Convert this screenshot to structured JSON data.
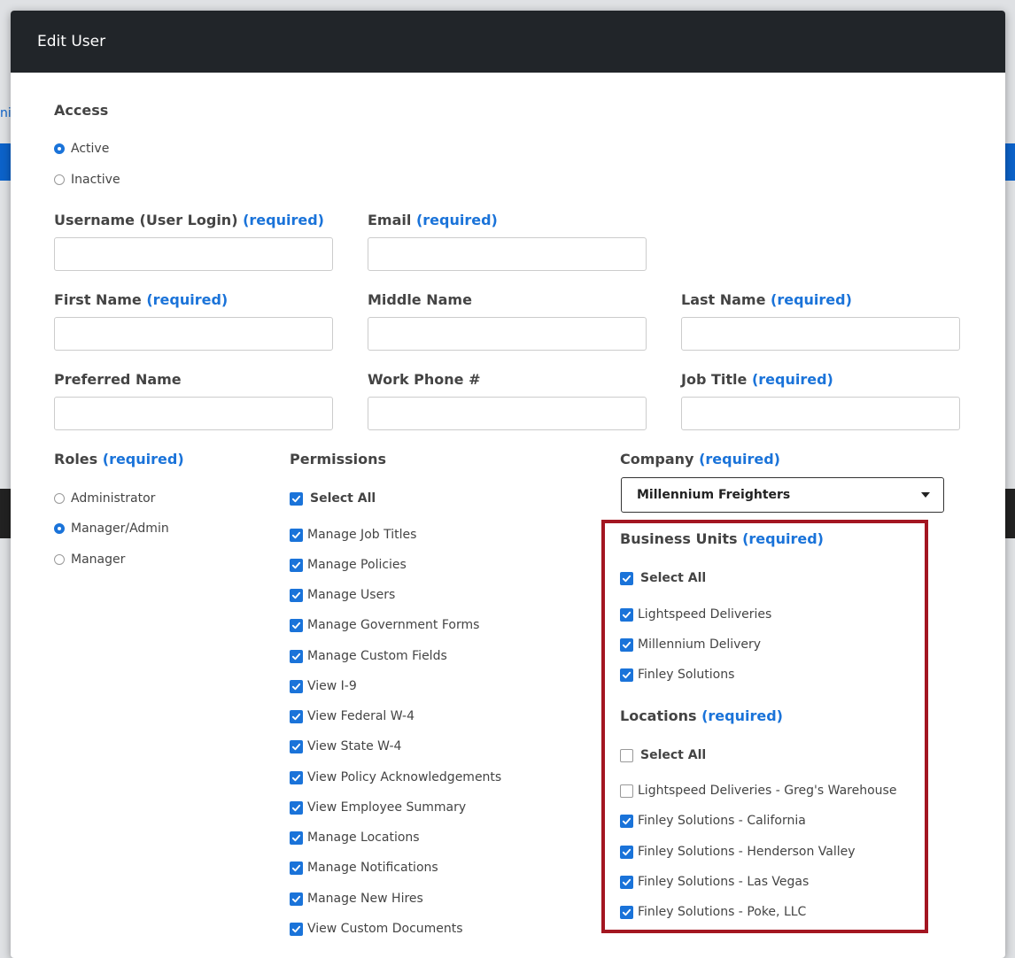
{
  "modal": {
    "title": "Edit User"
  },
  "access": {
    "title": "Access",
    "options": [
      {
        "label": "Active",
        "selected": true
      },
      {
        "label": "Inactive",
        "selected": false
      }
    ]
  },
  "required_text": "(required)",
  "fields": {
    "username": {
      "label": "Username (User Login)",
      "required": "(required)",
      "value": ""
    },
    "email": {
      "label": "Email",
      "required": "(required)",
      "value": ""
    },
    "first_name": {
      "label": "First Name",
      "required": "(required)",
      "value": ""
    },
    "middle_name": {
      "label": "Middle Name",
      "value": ""
    },
    "last_name": {
      "label": "Last Name",
      "required": "(required)",
      "value": ""
    },
    "preferred_name": {
      "label": "Preferred Name",
      "value": ""
    },
    "work_phone": {
      "label": "Work Phone #",
      "value": ""
    },
    "job_title": {
      "label": "Job Title",
      "required": "(required)",
      "value": ""
    }
  },
  "roles": {
    "title": "Roles",
    "required": "(required)",
    "options": [
      {
        "label": "Administrator",
        "selected": false
      },
      {
        "label": "Manager/Admin",
        "selected": true
      },
      {
        "label": "Manager",
        "selected": false
      }
    ]
  },
  "permissions": {
    "title": "Permissions",
    "select_all": {
      "label": "Select All",
      "checked": true
    },
    "items": [
      {
        "label": "Manage Job Titles",
        "checked": true
      },
      {
        "label": "Manage Policies",
        "checked": true
      },
      {
        "label": "Manage Users",
        "checked": true
      },
      {
        "label": "Manage Government Forms",
        "checked": true
      },
      {
        "label": "Manage Custom Fields",
        "checked": true
      },
      {
        "label": "View I-9",
        "checked": true
      },
      {
        "label": "View Federal W-4",
        "checked": true
      },
      {
        "label": "View State W-4",
        "checked": true
      },
      {
        "label": "View Policy Acknowledgements",
        "checked": true
      },
      {
        "label": "View Employee Summary",
        "checked": true
      },
      {
        "label": "Manage Locations",
        "checked": true
      },
      {
        "label": "Manage Notifications",
        "checked": true
      },
      {
        "label": "Manage New Hires",
        "checked": true
      },
      {
        "label": "View Custom Documents",
        "checked": true
      }
    ]
  },
  "company": {
    "title": "Company",
    "required": "(required)",
    "selected": "Millennium Freighters"
  },
  "business_units": {
    "title": "Business Units",
    "required": "(required)",
    "select_all": {
      "label": "Select All",
      "checked": true
    },
    "items": [
      {
        "label": "Lightspeed Deliveries",
        "checked": true
      },
      {
        "label": "Millennium Delivery",
        "checked": true
      },
      {
        "label": "Finley Solutions",
        "checked": true
      }
    ]
  },
  "locations": {
    "title": "Locations",
    "required": "(required)",
    "select_all": {
      "label": "Select All",
      "checked": false
    },
    "items": [
      {
        "label": "Lightspeed Deliveries - Greg's Warehouse",
        "checked": false
      },
      {
        "label": "Finley Solutions - California",
        "checked": true
      },
      {
        "label": "Finley Solutions - Henderson Valley",
        "checked": true
      },
      {
        "label": "Finley Solutions - Las Vegas",
        "checked": true
      },
      {
        "label": "Finley Solutions - Poke, LLC",
        "checked": true
      }
    ]
  },
  "colors": {
    "accent": "#1a73d9",
    "header_bg": "#212529",
    "highlight": "#a31621"
  },
  "background": {
    "edge_text": "ni"
  }
}
